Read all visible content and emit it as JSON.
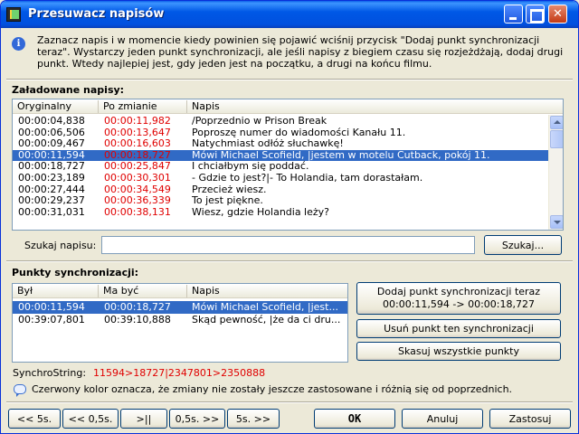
{
  "window": {
    "title": "Przesuwacz napisów"
  },
  "info": {
    "text": "Zaznacz napis i w momencie kiedy powinien się pojawić wciśnij przycisk \"Dodaj punkt synchronizacji teraz\". Wystarczy jeden punkt synchronizacji, ale jeśli napisy z biegiem czasu się rozjeżdżają, dodaj drugi punkt. Wtedy najlepiej jest, gdy jeden jest na początku, a drugi na końcu filmu."
  },
  "loaded": {
    "label": "Załadowane napisy:",
    "columns": [
      "Oryginalny",
      "Po zmianie",
      "Napis"
    ],
    "rows": [
      {
        "orig": "00:00:04,838",
        "new": "00:00:11,982",
        "text": "/Poprzednio w Prison Break",
        "selected": false
      },
      {
        "orig": "00:00:06,506",
        "new": "00:00:13,647",
        "text": "Poproszę numer do wiadomości Kanału 11.",
        "selected": false
      },
      {
        "orig": "00:00:09,467",
        "new": "00:00:16,603",
        "text": "Natychmiast odłóż słuchawkę!",
        "selected": false
      },
      {
        "orig": "00:00:11,594",
        "new": "00:00:18,727",
        "text": "Mówi Michael Scofield, |jestem w motelu Cutback, pokój 11.",
        "selected": true
      },
      {
        "orig": "00:00:18,727",
        "new": "00:00:25,847",
        "text": "I chciałbym się poddać.",
        "selected": false
      },
      {
        "orig": "00:00:23,189",
        "new": "00:00:30,301",
        "text": "- Gdzie to jest?|- To Holandia, tam dorastałam.",
        "selected": false
      },
      {
        "orig": "00:00:27,444",
        "new": "00:00:34,549",
        "text": "Przecież wiesz.",
        "selected": false
      },
      {
        "orig": "00:00:29,237",
        "new": "00:00:36,339",
        "text": "To jest piękne.",
        "selected": false
      },
      {
        "orig": "00:00:31,031",
        "new": "00:00:38,131",
        "text": "Wiesz, gdzie Holandia leży?",
        "selected": false
      }
    ]
  },
  "search": {
    "label": "Szukaj napisu:",
    "value": "",
    "button": "Szukaj..."
  },
  "sync": {
    "label": "Punkty synchronizacji:",
    "columns": [
      "Był",
      "Ma być",
      "Napis"
    ],
    "rows": [
      {
        "was": "00:00:11,594",
        "should": "00:00:18,727",
        "text": "Mówi Michael Scofield, |jest...",
        "selected": true
      },
      {
        "was": "00:39:07,801",
        "should": "00:39:10,888",
        "text": "Skąd pewność, |że da ci dru...",
        "selected": false
      }
    ],
    "add_button_line1": "Dodaj punkt synchronizacji teraz",
    "add_button_line2": "00:00:11,594 -> 00:00:18,727",
    "remove_button": "Usuń punkt ten synchronizacji",
    "clear_button": "Skasuj wszystkie punkty"
  },
  "synchro": {
    "label": "SynchroString:",
    "value": "11594>18727|2347801>2350888"
  },
  "note": {
    "text": "Czerwony kolor oznacza, że zmiany nie zostały jeszcze zastosowane i różnią się od poprzednich."
  },
  "nav": {
    "back5": "<< 5s.",
    "back05": "<< 0,5s.",
    "pause": ">||",
    "fwd05": "0,5s. >>",
    "fwd5": "5s. >>"
  },
  "actions": {
    "ok": "OK",
    "cancel": "Anuluj",
    "apply": "Zastosuj"
  },
  "colors": {
    "selection": "#316ac5",
    "changed_text": "#e00000",
    "titlebar": "#0058e6"
  }
}
